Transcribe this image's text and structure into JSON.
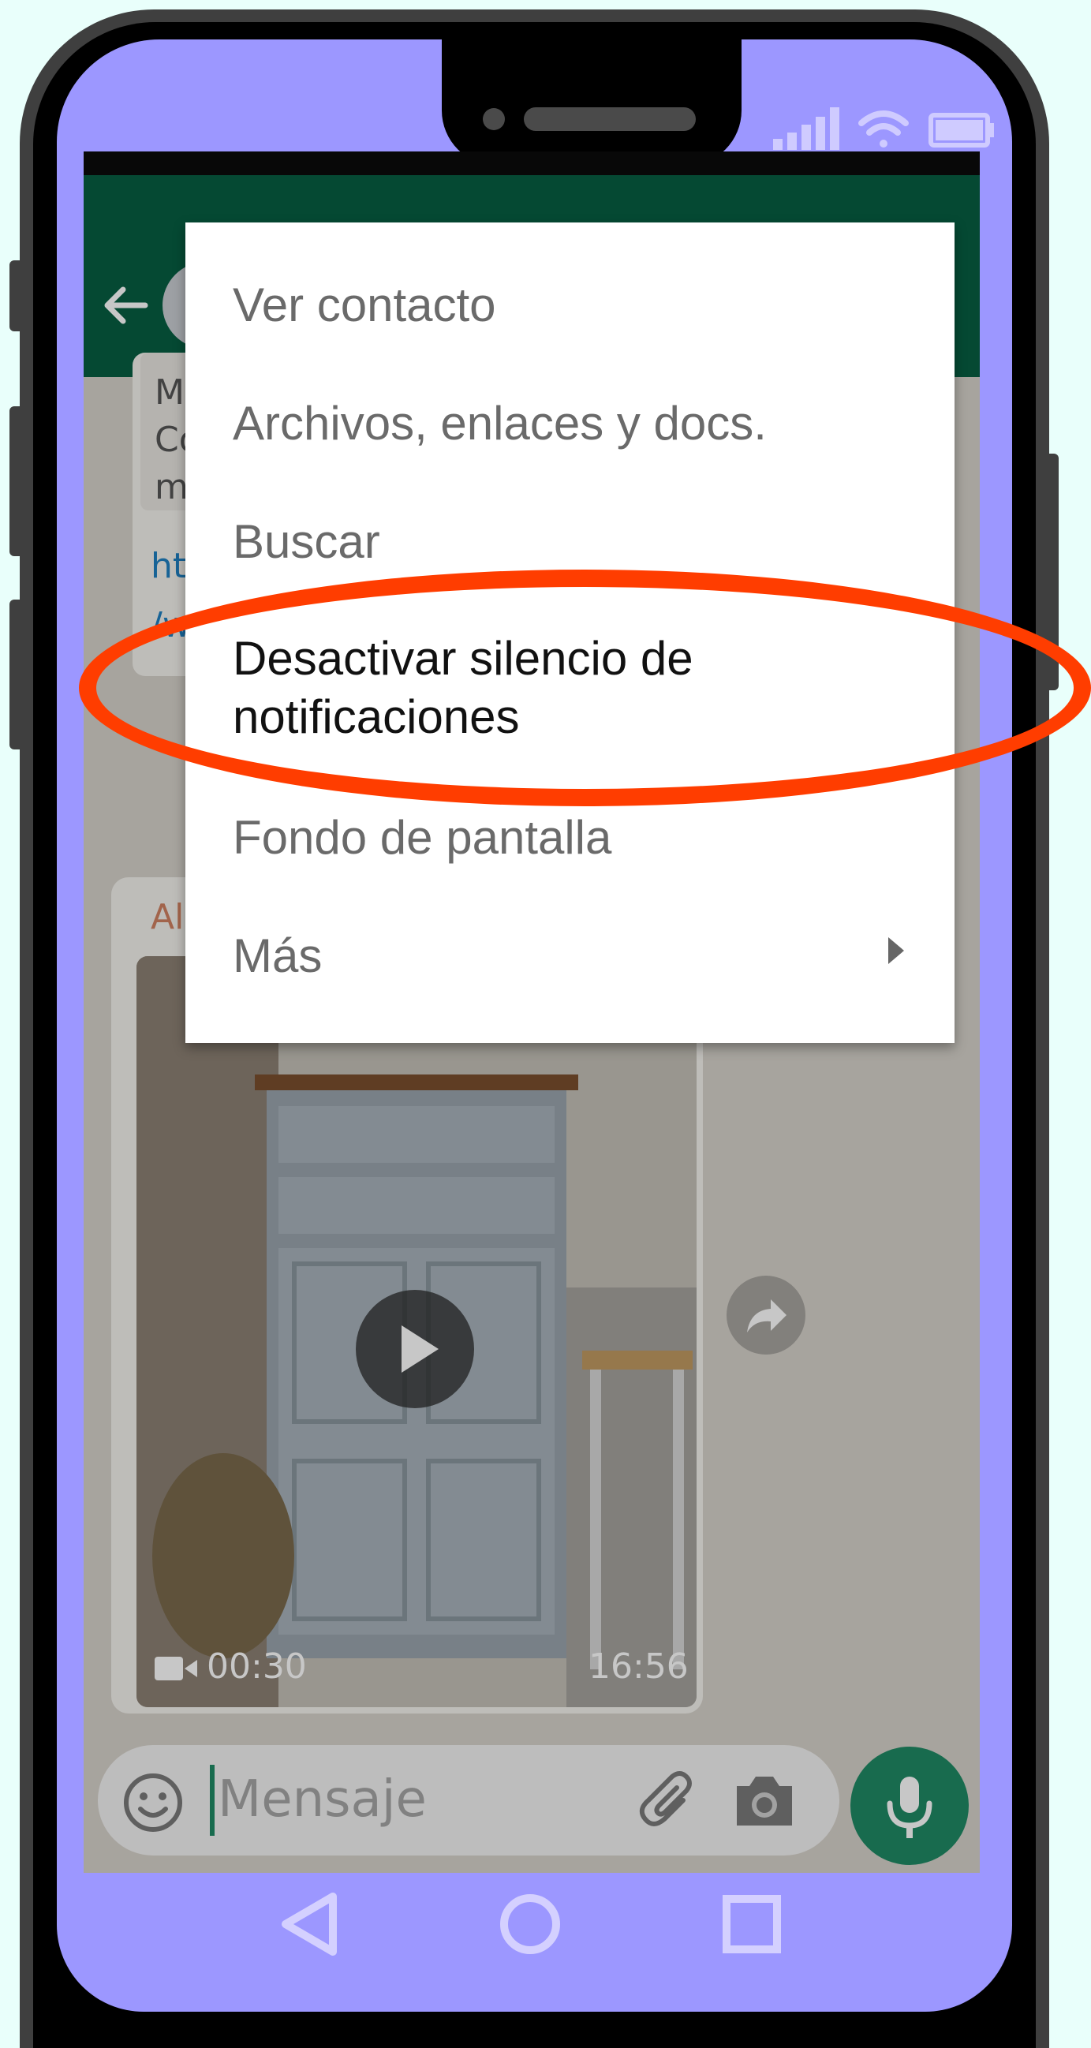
{
  "menu": {
    "items": [
      {
        "label": "Ver contacto"
      },
      {
        "label": "Archivos, enlaces y docs."
      },
      {
        "label": "Buscar"
      },
      {
        "label": "Desactivar silencio de",
        "label_line2": "notificaciones",
        "highlighted": true
      },
      {
        "label": "Fondo de pantalla"
      },
      {
        "label": "Más",
        "has_submenu": true
      }
    ]
  },
  "chat": {
    "partial_texts": [
      "M",
      "Co",
      "m",
      "ht",
      "/w",
      "Al"
    ],
    "video": {
      "duration": "00:30",
      "time": "16:56"
    },
    "input_placeholder": "Mensaje"
  },
  "colors": {
    "highlight": "#ff3d00",
    "header": "#075e42",
    "phone_screen": "#9c97ff",
    "mic_button": "#1f8a64"
  },
  "icons": [
    "back-arrow-icon",
    "signal-icon",
    "wifi-icon",
    "battery-icon",
    "play-icon",
    "forward-icon",
    "emoji-icon",
    "attach-icon",
    "camera-icon",
    "mic-icon",
    "nav-back-icon",
    "nav-home-icon",
    "nav-recents-icon",
    "video-camera-icon",
    "submenu-arrow-icon"
  ]
}
